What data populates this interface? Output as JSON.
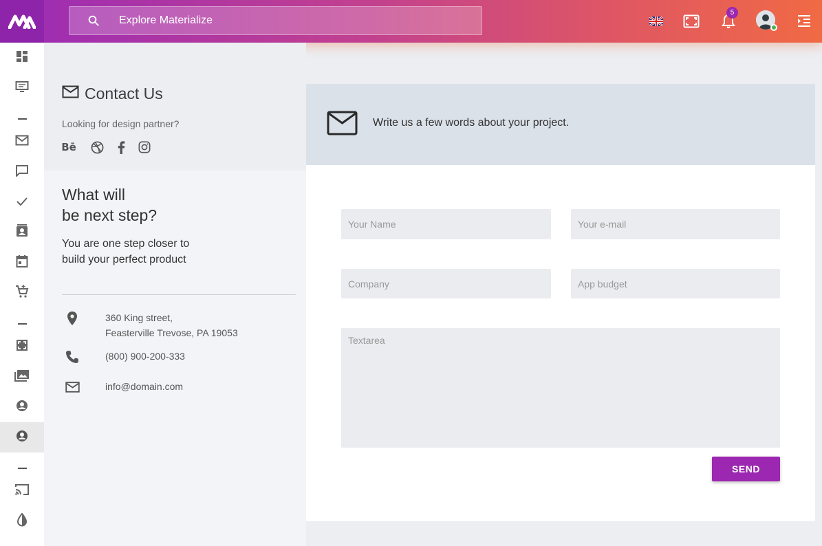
{
  "header": {
    "search_placeholder": "Explore Materialize",
    "notification_count": "5",
    "icons": [
      "logo-icon",
      "search-icon",
      "flag-uk-icon",
      "fullscreen-icon",
      "bell-icon",
      "avatar",
      "menu-indent-icon"
    ]
  },
  "sidebar": {
    "items": [
      {
        "icon": "dashboard-icon"
      },
      {
        "icon": "monitor-icon"
      },
      {
        "icon": "mail-icon"
      },
      {
        "icon": "chat-icon"
      },
      {
        "icon": "check-icon"
      },
      {
        "icon": "contacts-icon"
      },
      {
        "icon": "calendar-icon"
      },
      {
        "icon": "cart-icon"
      },
      {
        "icon": "expand-icon"
      },
      {
        "icon": "photos-icon"
      },
      {
        "icon": "account-icon"
      },
      {
        "icon": "account-active-icon"
      },
      {
        "icon": "cast-icon"
      },
      {
        "icon": "contrast-icon"
      }
    ]
  },
  "contact": {
    "title": "Contact Us",
    "tagline": "Looking for design partner?",
    "socials": [
      "behance-icon",
      "dribbble-icon",
      "facebook-icon",
      "instagram-icon"
    ],
    "next_title_line1": "What will",
    "next_title_line2": "be next step?",
    "next_desc": "You are one step closer to build your perfect product",
    "address_line1": "360 King street,",
    "address_line2": "Feasterville Trevose, PA 19053",
    "phone": "(800) 900-200-333",
    "email": "info@domain.com"
  },
  "form": {
    "header_text": "Write us a few words about your project.",
    "name_placeholder": "Your Name",
    "email_placeholder": "Your e-mail",
    "company_placeholder": "Company",
    "budget_placeholder": "App budget",
    "textarea_placeholder": "Textarea",
    "send_label": "SEND"
  },
  "colors": {
    "accent": "#9c27b0",
    "header_gradient_start": "#9b2bb5",
    "header_gradient_end": "#f06a44"
  }
}
